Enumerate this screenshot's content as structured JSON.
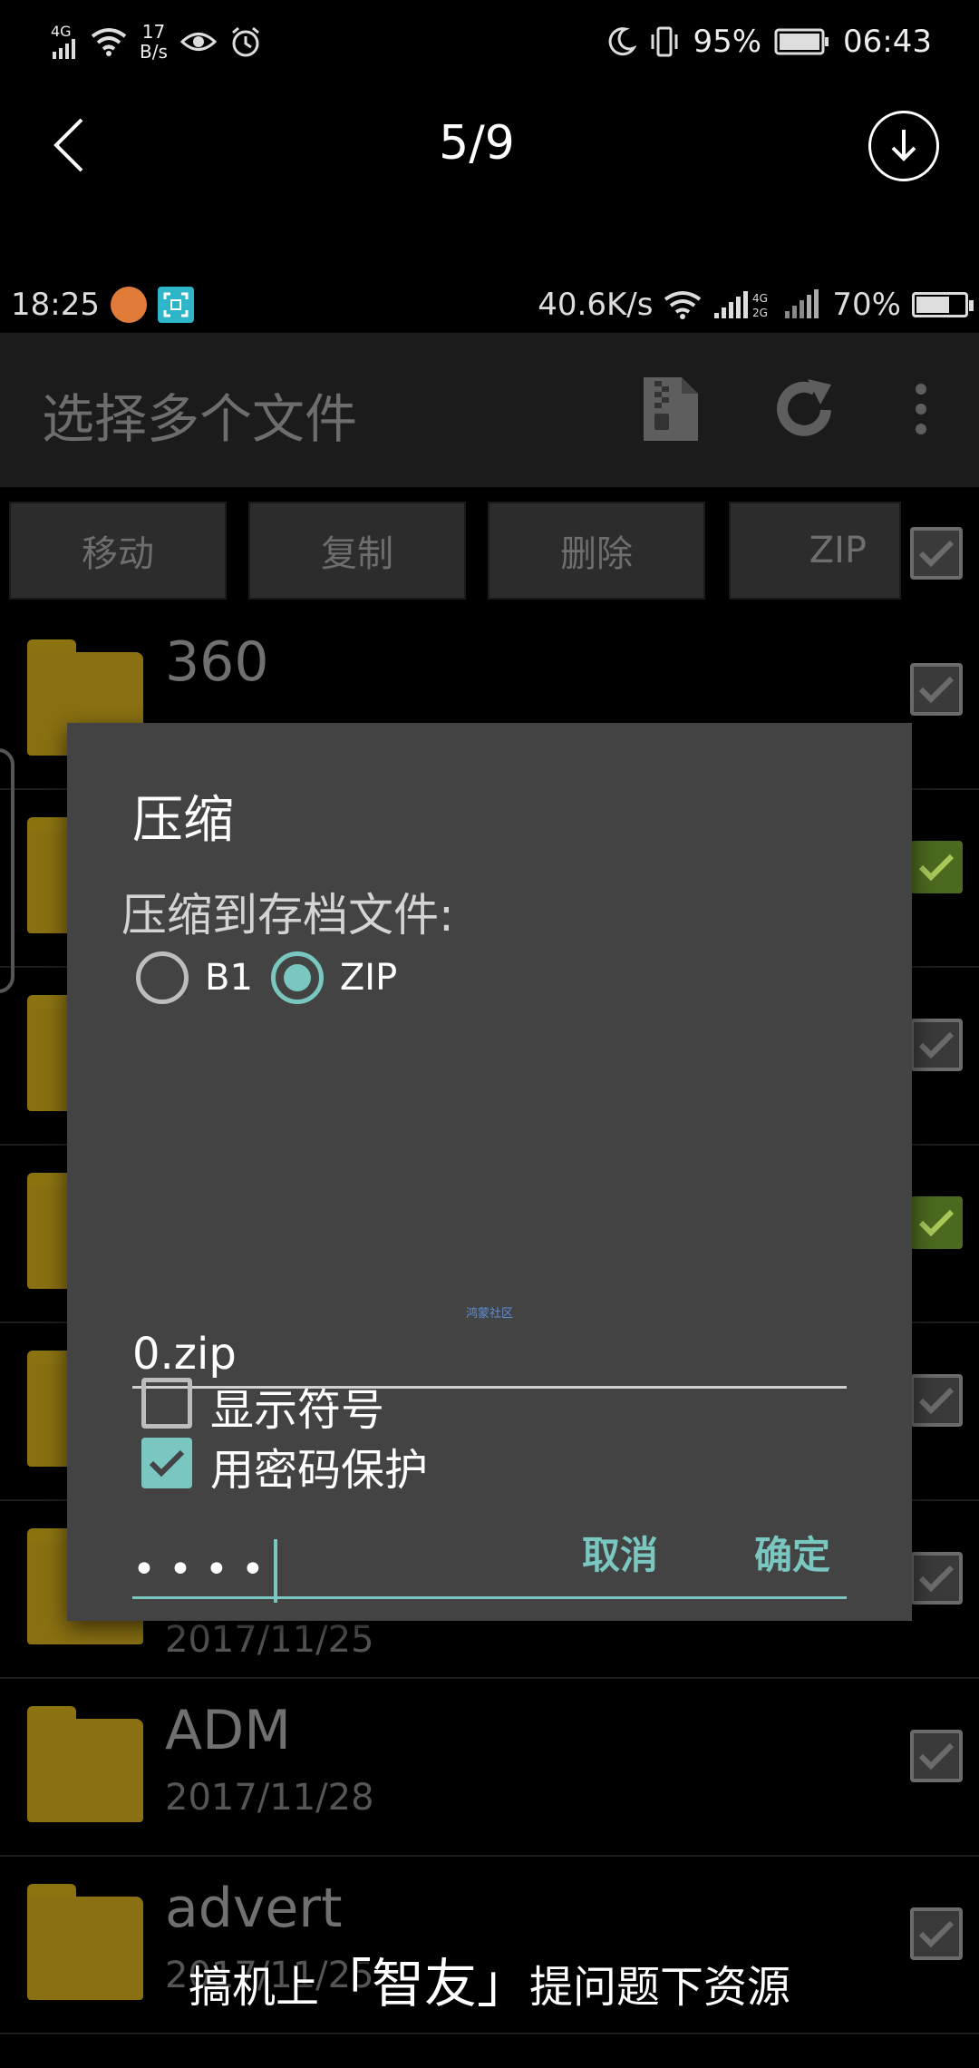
{
  "outer_status": {
    "network": "4G",
    "speed_value": "17",
    "speed_unit": "B/s",
    "battery": "95%",
    "time": "06:43"
  },
  "viewer": {
    "counter": "5/9"
  },
  "inner_status": {
    "time": "18:25",
    "speed": "40.6K/s",
    "battery": "70%",
    "battery_level": 0.7
  },
  "toolbar": {
    "title": "选择多个文件"
  },
  "actions": {
    "move": "移动",
    "copy": "复制",
    "delete": "删除",
    "zip": "ZIP"
  },
  "files": [
    {
      "name": "360",
      "date": ""
    },
    {
      "name": "",
      "date": "2017/11/25"
    },
    {
      "name": "ADM",
      "date": "2017/11/28"
    },
    {
      "name": "advert",
      "date": "2017/11/25"
    }
  ],
  "dialog": {
    "title": "压缩",
    "subtitle": "压缩到存档文件:",
    "radio_b1": "B1",
    "radio_zip": "ZIP",
    "watermark": "鸿蒙社区",
    "filename": "0.zip",
    "password_protect": "用密码保护",
    "password_value": "••••",
    "show_symbols": "显示符号",
    "cancel": "取消",
    "confirm": "确定"
  },
  "caption": {
    "before": "搞机上",
    "highlight": "「智友」",
    "after": "提问题下资源"
  },
  "colors": {
    "accent": "#7ac7c1",
    "dialog_bg": "#434343",
    "folder": "#8a7012",
    "check_green": "#4b6a1f"
  }
}
